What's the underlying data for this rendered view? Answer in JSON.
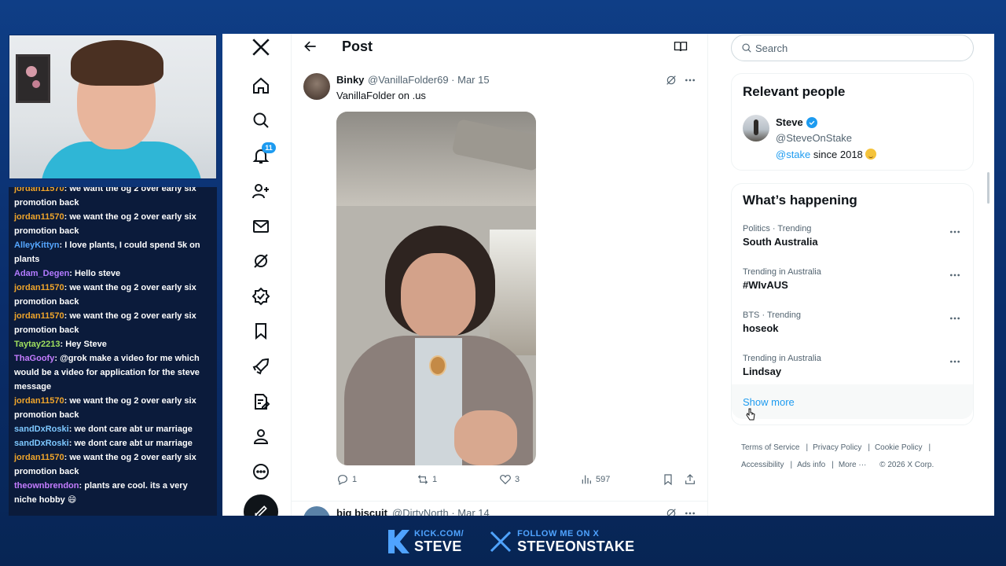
{
  "chat": {
    "messages": [
      {
        "user": "jordan11570",
        "text": "we want the og 2 over early six promotion back",
        "color": "#f0a52b"
      },
      {
        "user": "jordan11570",
        "text": "we want the og 2 over early six promotion back",
        "color": "#f0a52b"
      },
      {
        "user": "AlleyKittyn",
        "text": "I love plants, I could spend 5k on plants",
        "color": "#55a6ff"
      },
      {
        "user": "Adam_Degen",
        "text": "Hello steve",
        "color": "#b27aff"
      },
      {
        "user": "jordan11570",
        "text": "we want the og 2 over early six promotion back",
        "color": "#f0a52b"
      },
      {
        "user": "jordan11570",
        "text": "we want the og 2 over early six promotion back",
        "color": "#f0a52b"
      },
      {
        "user": "Taytay2213",
        "text": "Hey Steve",
        "color": "#9fe05e"
      },
      {
        "user": "ThaGoofy",
        "text": "@grok make a video for me which would be a video for application for the steve message",
        "color": "#c47cff"
      },
      {
        "user": "jordan11570",
        "text": "we want the og 2 over early six promotion back",
        "color": "#f0a52b"
      },
      {
        "user": "sandDxRoski",
        "text": "we dont care abt ur marriage",
        "color": "#7ec8ff"
      },
      {
        "user": "sandDxRoski",
        "text": "we dont care abt ur marriage",
        "color": "#7ec8ff"
      },
      {
        "user": "jordan11570",
        "text": "we want the og 2 over early six promotion back",
        "color": "#f0a52b"
      },
      {
        "user": "theownbrendon",
        "text": "plants are cool. its a very niche hobby 😄",
        "color": "#c47cff"
      }
    ]
  },
  "nav": {
    "notifications_badge": "11"
  },
  "header": {
    "title": "Post"
  },
  "tweet": {
    "name": "Binky",
    "handle_date": "@VanillaFolder69 · Mar 15",
    "text": "VanillaFolder on .us",
    "replies": "1",
    "reposts": "1",
    "likes": "3",
    "views": "597"
  },
  "next_tweet": {
    "name": "big biscuit",
    "handle_date": "@DirtyNorth · Mar 14"
  },
  "search": {
    "placeholder": "Search"
  },
  "relevant": {
    "title": "Relevant people",
    "name": "Steve",
    "handle": "@SteveOnStake",
    "bio_link": "@stake",
    "bio_rest": " since 2018"
  },
  "happening": {
    "title": "What’s happening",
    "trends": [
      {
        "meta": "Politics · Trending",
        "name": "South Australia"
      },
      {
        "meta": "Trending in Australia",
        "name": "#WIvAUS"
      },
      {
        "meta": "BTS · Trending",
        "name": "hoseok"
      },
      {
        "meta": "Trending in Australia",
        "name": "Lindsay"
      }
    ],
    "show_more": "Show more"
  },
  "footer": {
    "terms": "Terms of Service",
    "privacy": "Privacy Policy",
    "cookie": "Cookie Policy",
    "accessibility": "Accessibility",
    "ads": "Ads info",
    "more": "More ···",
    "copyright": "© 2026 X Corp."
  },
  "banner": {
    "kick_small": "KICK.COM/",
    "kick_big": "STEVE",
    "x_small": "FOLLOW ME ON X",
    "x_big": "STEVEONSTAKE"
  }
}
